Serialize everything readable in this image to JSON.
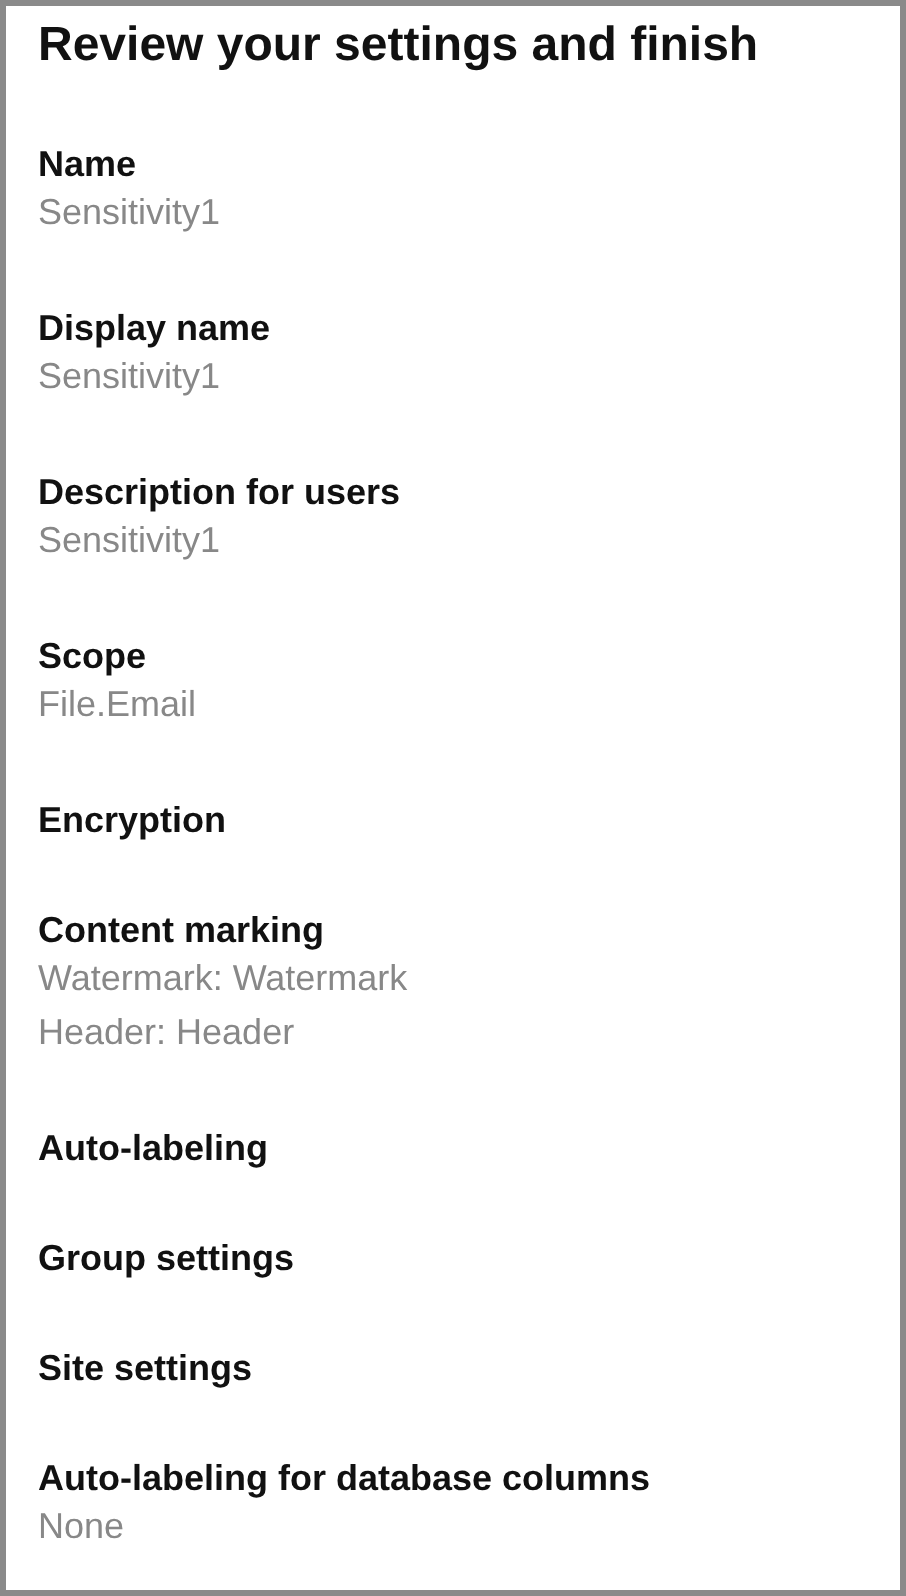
{
  "title": "Review your settings and finish",
  "sections": [
    {
      "label": "Name",
      "values": [
        "Sensitivity1"
      ]
    },
    {
      "label": "Display name",
      "values": [
        "Sensitivity1"
      ]
    },
    {
      "label": "Description for users",
      "values": [
        "Sensitivity1"
      ]
    },
    {
      "label": "Scope",
      "values": [
        "File.Email"
      ]
    },
    {
      "label": "Encryption"
    },
    {
      "label": "Content marking",
      "values": [
        "Watermark: Watermark",
        "Header: Header"
      ]
    },
    {
      "label": "Auto-labeling"
    },
    {
      "label": "Group settings"
    },
    {
      "label": "Site settings"
    },
    {
      "label": "Auto-labeling for database columns",
      "values": [
        "None"
      ]
    }
  ]
}
